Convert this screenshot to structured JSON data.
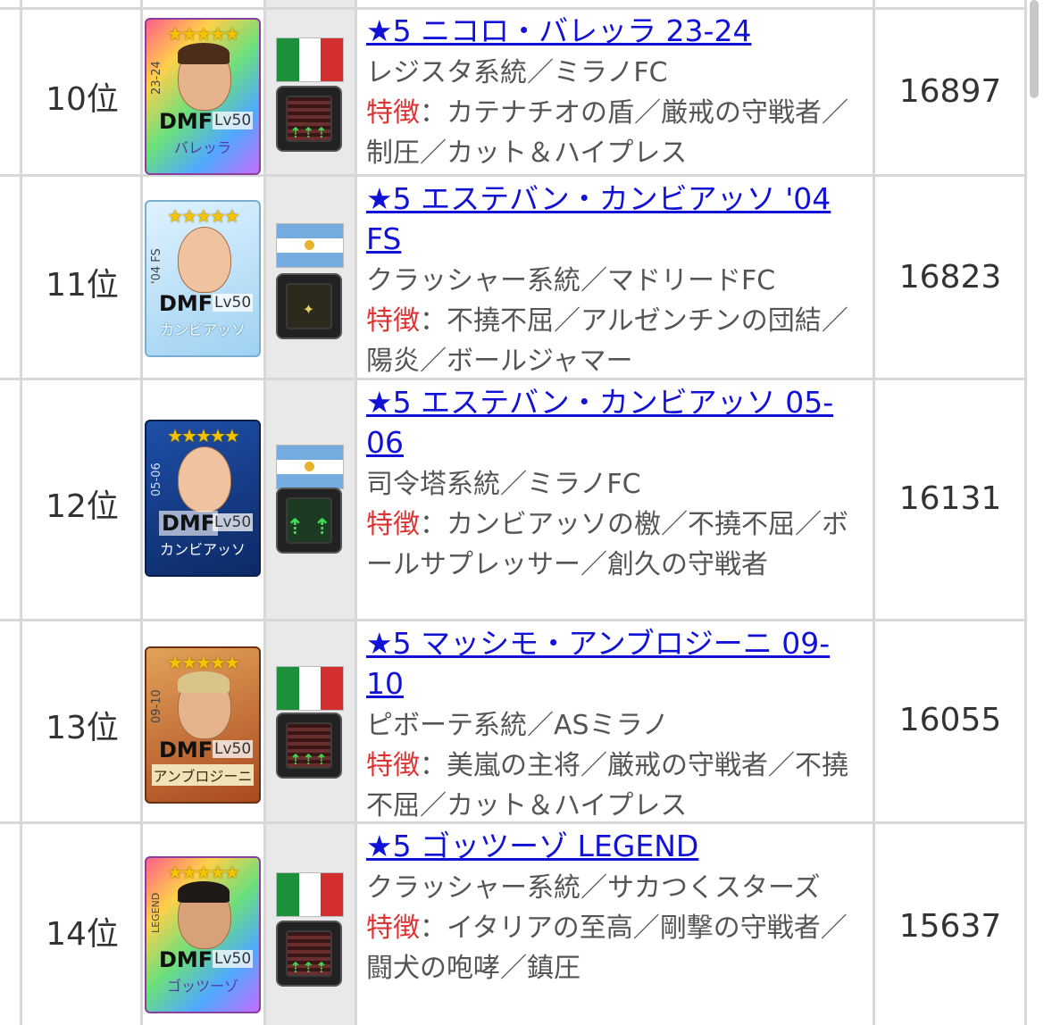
{
  "rows": [
    {
      "rank": "10位",
      "title": "★5 ニコロ・バレッラ 23-24",
      "line1": "レジスタ系統／ミラノFC",
      "feature_label": "特徴",
      "feature_text": "：カテナチオの盾／厳戒の守戦者／制圧／カット＆ハイプレス",
      "score": "16897",
      "card": {
        "season": "23-24",
        "position": "DMF",
        "level": "Lv50",
        "name": "バレッラ"
      },
      "flag": "italy",
      "tactic": "press-arrows"
    },
    {
      "rank": "11位",
      "title": "★5 エステバン・カンビアッソ '04 FS",
      "line1": "クラッシャー系統／マドリードFC",
      "feature_label": "特徴",
      "feature_text": "：不撓不屈／アルゼンチンの団結／陽炎／ボールジャマー",
      "score": "16823",
      "card": {
        "season": "'04 FS",
        "position": "DMF",
        "level": "Lv50",
        "name": "カンビアッソ"
      },
      "flag": "argentina",
      "tactic": "pass-network"
    },
    {
      "rank": "12位",
      "title": "★5 エステバン・カンビアッソ 05-06",
      "line1": "司令塔系統／ミラノFC",
      "feature_label": "特徴",
      "feature_text": "：カンビアッソの檄／不撓不屈／ボールサプレッサー／創久の守戦者",
      "score": "16131",
      "card": {
        "season": "05-06",
        "position": "DMF",
        "level": "Lv50",
        "name": "カンビアッソ"
      },
      "flag": "argentina",
      "tactic": "long-arrows"
    },
    {
      "rank": "13位",
      "title": "★5 マッシモ・アンブロジーニ 09-10",
      "line1": "ピボーテ系統／ASミラノ",
      "feature_label": "特徴",
      "feature_text": "：美嵐の主将／厳戒の守戦者／不撓不屈／カット＆ハイプレス",
      "score": "16055",
      "card": {
        "season": "09-10",
        "position": "DMF",
        "level": "Lv50",
        "name": "アンブロジーニ"
      },
      "flag": "italy",
      "tactic": "press-arrows"
    },
    {
      "rank": "14位",
      "title": "★5 ゴッツーゾ LEGEND",
      "line1": "クラッシャー系統／サカつくスターズ",
      "feature_label": "特徴",
      "feature_text": "：イタリアの至高／剛撃の守戦者／闘犬の咆哮／鎮圧",
      "score": "15637",
      "card": {
        "season": "LEGEND",
        "position": "DMF",
        "level": "Lv50",
        "name": "ゴッツーゾ"
      },
      "flag": "italy",
      "tactic": "press-arrows"
    }
  ],
  "stars": "★★★★★",
  "tactic_arrows": {
    "press": "⇡⇡⇡",
    "long": "⇡ ⇡"
  },
  "colors": {
    "link": "#1212d6",
    "feature_label": "#dd3333",
    "grid": "#d8d8d8",
    "flag_column": "#e9e9e9"
  }
}
